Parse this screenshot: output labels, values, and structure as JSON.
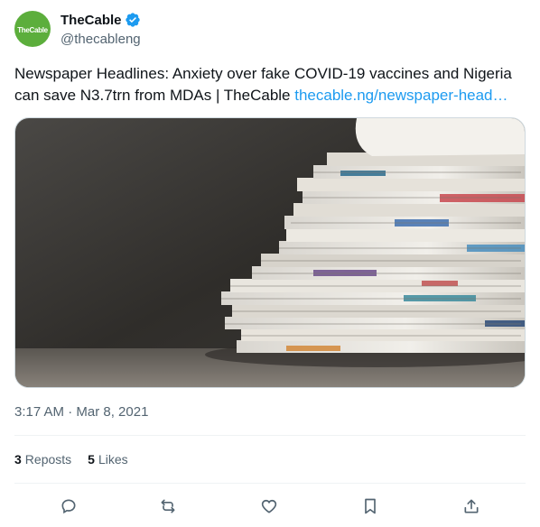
{
  "author": {
    "avatar_text": "TheCable",
    "display_name": "TheCable",
    "handle": "@thecableng",
    "verified": true
  },
  "tweet": {
    "text_line1": "Newspaper Headlines: Anxiety over fake COVID-19 vaccines and Nigeria",
    "text_line2": "can save N3.7trn from MDAs | TheCable ",
    "link_text": "thecable.ng/newspaper-head…",
    "media_alt": "newspapers stack photo",
    "timestamp": "3:17 AM · Mar 8, 2021"
  },
  "stats": {
    "reposts_count": "3",
    "reposts_label": "Reposts",
    "likes_count": "5",
    "likes_label": "Likes"
  },
  "actions": [
    "reply-icon",
    "repost-icon",
    "like-icon",
    "bookmark-icon",
    "share-icon"
  ],
  "colors": {
    "link": "#1d9bf0",
    "avatar_bg": "#5cae3c",
    "muted": "#536471",
    "text": "#0f1419"
  }
}
